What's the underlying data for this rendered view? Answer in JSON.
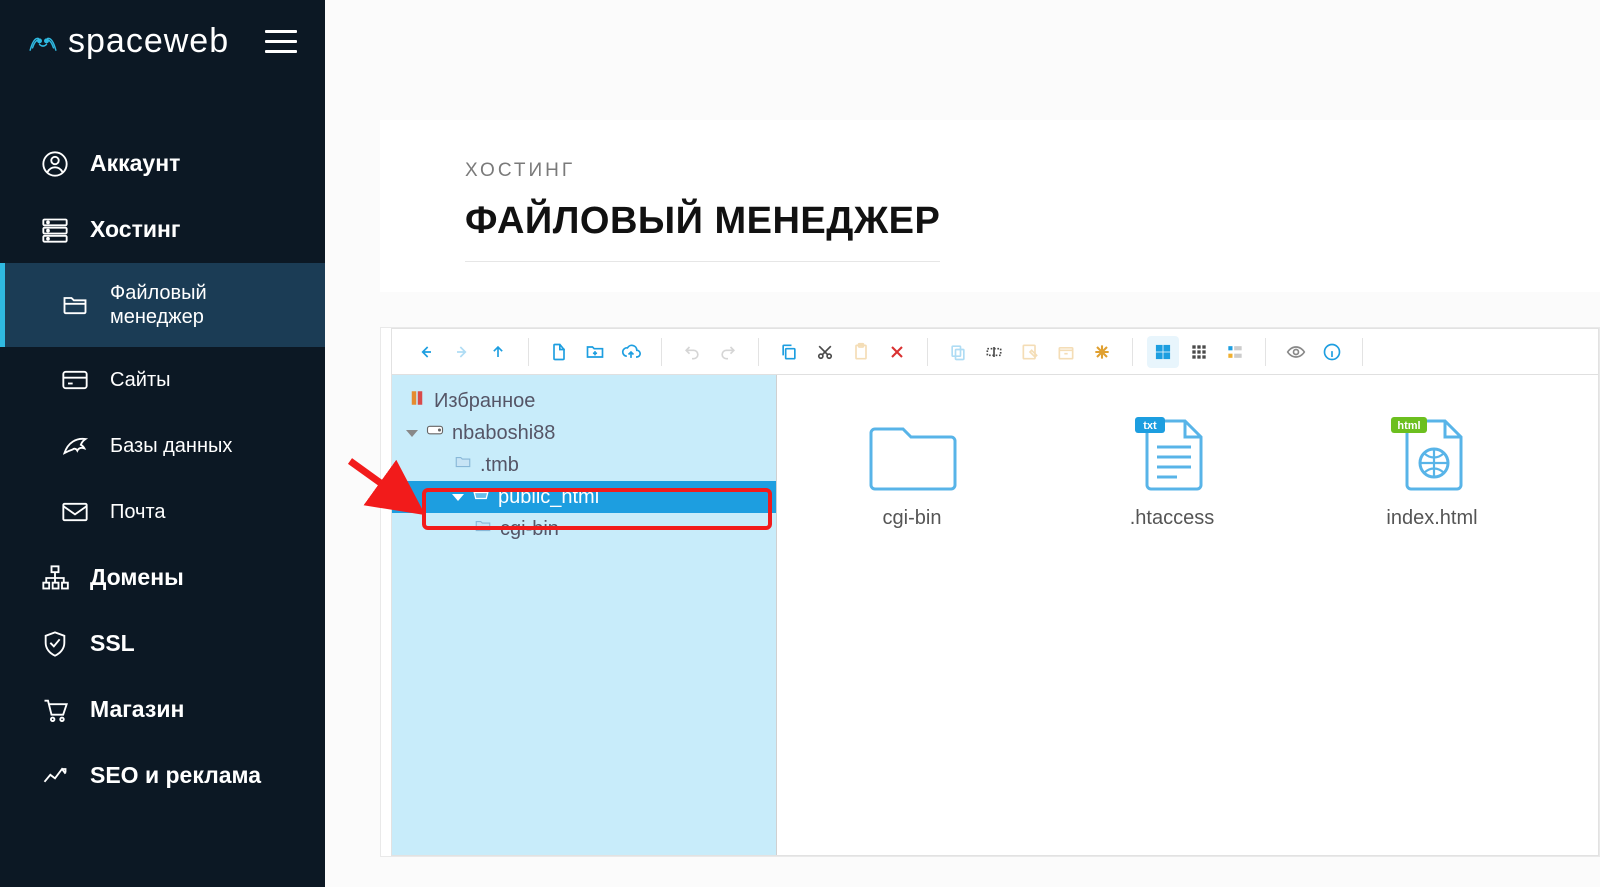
{
  "brand": {
    "name": "spaceweb",
    "accent": "#2fb9e1"
  },
  "sidebar": {
    "items": [
      {
        "id": "account",
        "label": "Аккаунт"
      },
      {
        "id": "hosting",
        "label": "Хостинг"
      },
      {
        "id": "filemgr",
        "label": "Файловый менеджер"
      },
      {
        "id": "sites",
        "label": "Сайты"
      },
      {
        "id": "db",
        "label": "Базы данных"
      },
      {
        "id": "mail",
        "label": "Почта"
      },
      {
        "id": "domains",
        "label": "Домены"
      },
      {
        "id": "ssl",
        "label": "SSL"
      },
      {
        "id": "shop",
        "label": "Магазин"
      },
      {
        "id": "seo",
        "label": "SEO и реклама"
      }
    ]
  },
  "page": {
    "breadcrumb": "ХОСТИНГ",
    "title": "ФАЙЛОВЫЙ МЕНЕДЖЕР"
  },
  "tree": {
    "favorites": "Избранное",
    "root": "nbaboshi88",
    "nodes": {
      "tmb": ".tmb",
      "public_html": "public_html",
      "cgi_bin": "cgi-bin"
    }
  },
  "files": [
    {
      "name": "cgi-bin",
      "type": "folder"
    },
    {
      "name": ".htaccess",
      "type": "txt",
      "badge": "txt",
      "badge_color": "#1d9ee0"
    },
    {
      "name": "index.html",
      "type": "html",
      "badge": "html",
      "badge_color": "#6cbf1f"
    }
  ],
  "toolbar_groups": [
    {
      "id": "nav",
      "buttons": [
        "back",
        "forward",
        "up"
      ]
    },
    {
      "id": "file",
      "buttons": [
        "newfile",
        "newfolder",
        "upload"
      ]
    },
    {
      "id": "undo",
      "buttons": [
        "undo",
        "redo"
      ]
    },
    {
      "id": "edit",
      "buttons": [
        "copy",
        "cut",
        "paste",
        "delete"
      ]
    },
    {
      "id": "sel",
      "buttons": [
        "duplicate",
        "rename",
        "edit",
        "archive",
        "extract"
      ]
    },
    {
      "id": "view",
      "buttons": [
        "icons-large",
        "icons-small",
        "list"
      ]
    },
    {
      "id": "info",
      "buttons": [
        "preview",
        "info"
      ]
    }
  ],
  "colors": {
    "sidebar_bg": "#0c1824",
    "sidebar_selected": "#1b3c55",
    "accent": "#2fb9e1",
    "tree_bg": "#c8ecfa",
    "tree_selected": "#1d9ee0",
    "highlight": "#f21b1b"
  }
}
